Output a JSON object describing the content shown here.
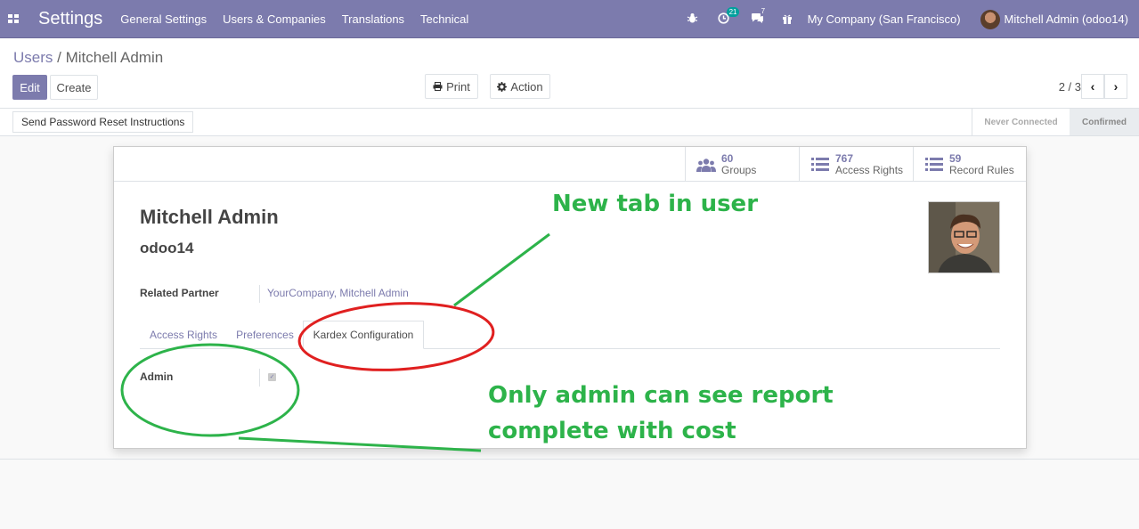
{
  "navbar": {
    "app_title": "Settings",
    "menu": [
      "General Settings",
      "Users & Companies",
      "Translations",
      "Technical"
    ],
    "activity_count": "21",
    "messages_count": "7",
    "company": "My Company (San Francisco)",
    "user": "Mitchell Admin (odoo14)"
  },
  "breadcrumb": {
    "parent": "Users",
    "separator": "/",
    "current": "Mitchell Admin"
  },
  "buttons": {
    "edit": "Edit",
    "create": "Create",
    "print": "Print",
    "action": "Action"
  },
  "pager": {
    "value": "2 / 3"
  },
  "statusbar": {
    "reset": "Send Password Reset Instructions",
    "stages": [
      "Never Connected",
      "Confirmed"
    ],
    "active_stage": "Confirmed"
  },
  "stats": [
    {
      "count": "60",
      "label": "Groups",
      "icon": "users-icon"
    },
    {
      "count": "767",
      "label": "Access Rights",
      "icon": "list-icon"
    },
    {
      "count": "59",
      "label": "Record Rules",
      "icon": "list-icon"
    }
  ],
  "record": {
    "name": "Mitchell Admin",
    "login": "odoo14",
    "related_partner_label": "Related Partner",
    "related_partner_value": "YourCompany, Mitchell Admin",
    "admin_label": "Admin",
    "admin_checked": true
  },
  "tabs": [
    "Access Rights",
    "Preferences",
    "Kardex Configuration"
  ],
  "active_tab": "Kardex Configuration",
  "annotations": {
    "top": "New tab in user",
    "bottom_line1": "Only admin can see report",
    "bottom_line2": "complete with cost"
  },
  "colors": {
    "brand": "#7c7bad",
    "annotation_green": "#2db34a",
    "annotation_red": "#e02020"
  }
}
